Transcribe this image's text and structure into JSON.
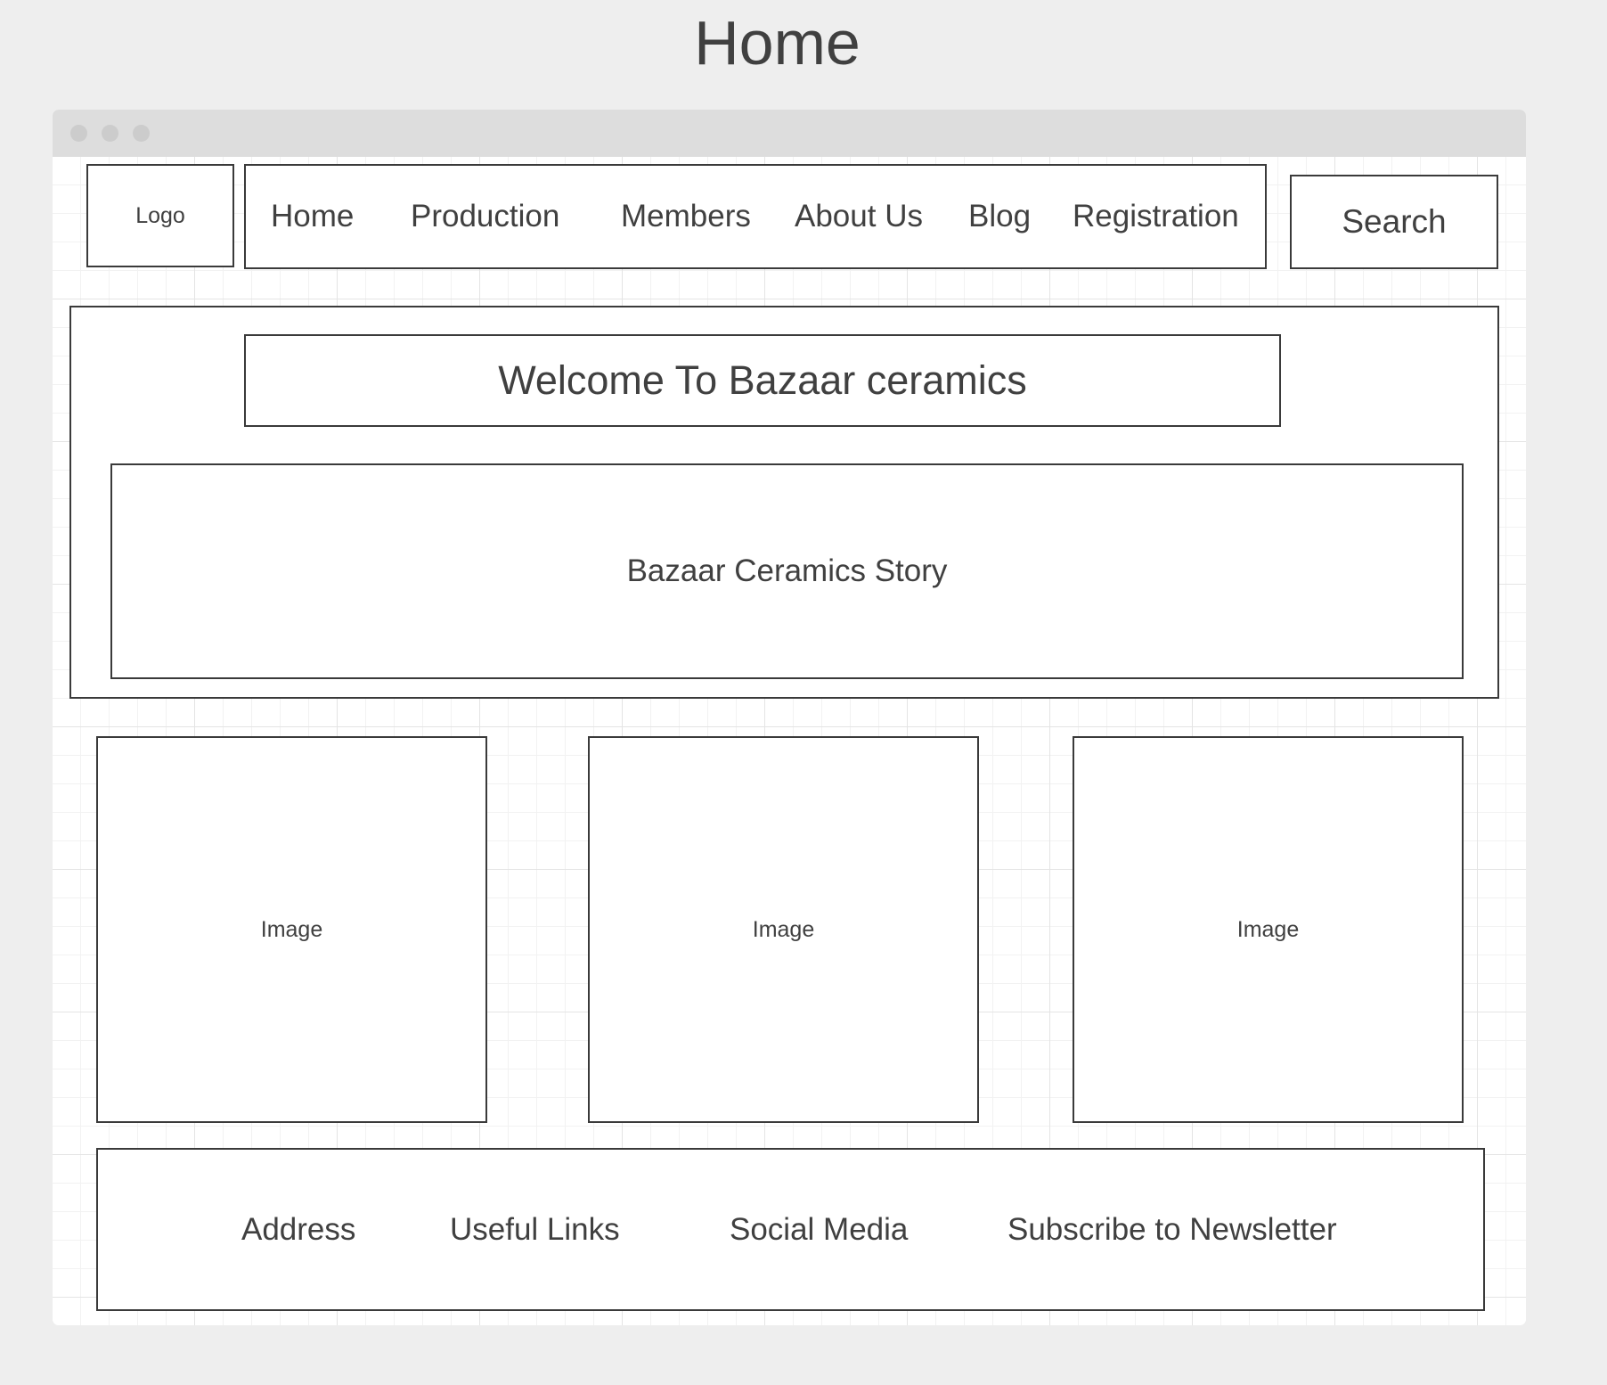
{
  "page": {
    "title": "Home"
  },
  "header": {
    "logo": "Logo",
    "nav": [
      "Home",
      "Production",
      "Members",
      "About Us",
      "Blog",
      "Registration"
    ],
    "search": "Search"
  },
  "hero": {
    "welcome": "Welcome To Bazaar ceramics",
    "story": "Bazaar Ceramics Story"
  },
  "gallery": {
    "images": [
      "Image",
      "Image",
      "Image"
    ]
  },
  "footer": {
    "items": [
      "Address",
      "Useful Links",
      "Social Media",
      "Subscribe to Newsletter"
    ]
  },
  "colors": {
    "page_background": "#eeeeee",
    "titlebar": "#dddddd",
    "border": "#3a3a3a",
    "text": "#404040"
  }
}
